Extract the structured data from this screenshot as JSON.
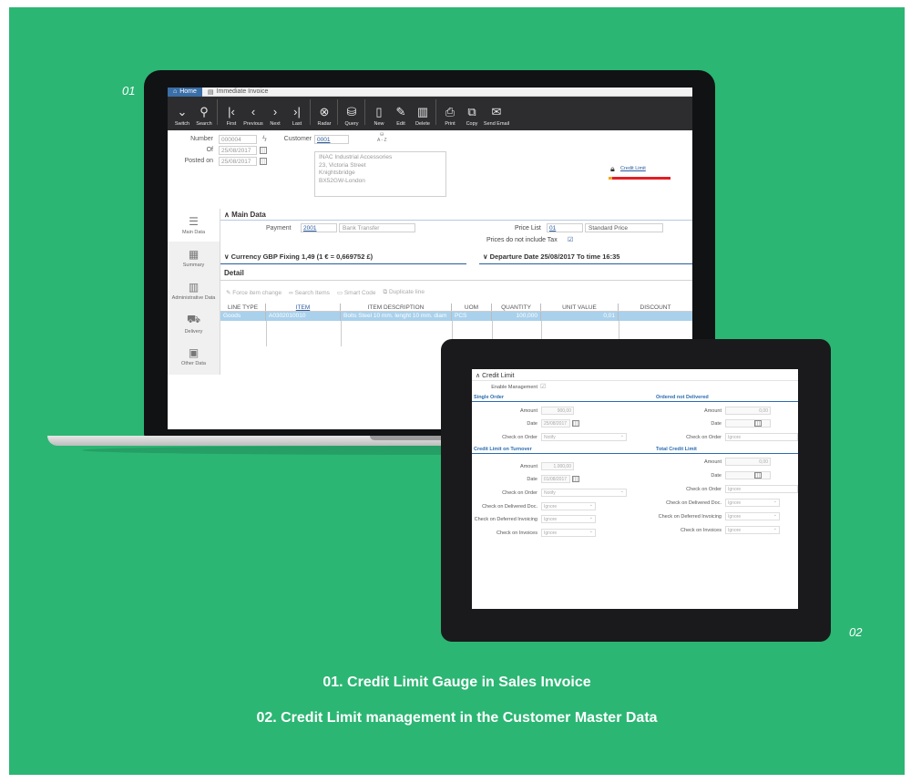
{
  "labels": {
    "one": "01",
    "two": "02"
  },
  "captions": {
    "first": "01. Credit Limit Gauge in Sales Invoice",
    "second": "02. Credit Limit management in the Customer Master Data"
  },
  "colors": {
    "background": "#2bb673",
    "gauge_red": "#e31e24",
    "gauge_orange": "#f5a623",
    "accent_blue": "#2b5c9f"
  },
  "app": {
    "tabs": {
      "home": "Home",
      "document": "Immediate Invoice"
    },
    "toolbar": [
      {
        "label": "Switch",
        "icon": "chevron-down-icon"
      },
      {
        "label": "Search",
        "icon": "search-icon"
      },
      {
        "label": "First",
        "icon": "first-icon"
      },
      {
        "label": "Previous",
        "icon": "previous-icon"
      },
      {
        "label": "Next",
        "icon": "next-icon"
      },
      {
        "label": "Last",
        "icon": "last-icon"
      },
      {
        "label": "Radar",
        "icon": "radar-icon"
      },
      {
        "label": "Query",
        "icon": "database-icon"
      },
      {
        "label": "New",
        "icon": "new-document-icon"
      },
      {
        "label": "Edit",
        "icon": "edit-icon"
      },
      {
        "label": "Delete",
        "icon": "delete-icon"
      },
      {
        "label": "Print",
        "icon": "print-icon"
      },
      {
        "label": "Copy",
        "icon": "copy-icon"
      },
      {
        "label": "Send Email",
        "icon": "email-icon"
      }
    ],
    "header": {
      "number_label": "Number",
      "number": "000004",
      "of_label": "Of",
      "of_date": "25/08/2017",
      "posted_label": "Posted on",
      "posted_date": "25/08/2017",
      "customer_label": "Customer",
      "customer_code": "0001",
      "sort_hint": "A - Z",
      "address": [
        "INAC Industrial Accessories",
        "23, Victoria Street",
        "Knightsbridge",
        "BX52GW-London"
      ],
      "credit_limit_link": "Credit Limit"
    },
    "sidenav": [
      "Main Data",
      "Summary",
      "Administrative Data",
      "Delivery",
      "Other Data"
    ],
    "main_data": {
      "title": "Main Data",
      "payment_label": "Payment",
      "payment_code": "2001",
      "payment_desc": "Bank Transfer",
      "price_list_label": "Price List",
      "price_list_code": "01",
      "price_list_desc": "Standard Price",
      "tax_label": "Prices do not include Tax",
      "currency_title": "Currency GBP Fixing 1,49 (1 € = 0,669752 £)",
      "departure_title": "Departure Date 25/08/2017 To time 16:35"
    },
    "detail": {
      "title": "Detail",
      "actions": [
        "Force item change",
        "Search Items",
        "Smart Code",
        "Duplicate line"
      ],
      "columns": [
        "LINE TYPE",
        "ITEM",
        "ITEM DESCRIPTION",
        "UOM",
        "QUANTITY",
        "UNIT VALUE",
        "DISCOUNT"
      ],
      "rows": [
        {
          "line_type": "Goods",
          "item": "A0302010010",
          "description": "Bolts Steel 10 mm. lenght 10 mm. diam",
          "uom": "PCS",
          "quantity": "100,000",
          "unit_value": "0,01",
          "discount": ""
        }
      ]
    }
  },
  "tablet": {
    "title": "Credit Limit",
    "enable_label": "Enable Management",
    "single_order": {
      "title": "Single Order",
      "amount_label": "Amount",
      "amount": "900,00",
      "date_label": "Date",
      "date": "25/08/2017",
      "check_label": "Check on Order",
      "check": "Notify"
    },
    "ordered_not_delivered": {
      "title": "Ordered not Delivered",
      "amount_label": "Amount",
      "amount": "0,00",
      "date_label": "Date",
      "check_label": "Check on Order",
      "check": "Ignore"
    },
    "turnover": {
      "title": "Credit Limit on Turnover",
      "amount_label": "Amount",
      "amount": "1.000,00",
      "date_label": "Date",
      "date": "01/08/2017",
      "check_order_label": "Check on Order",
      "check_order": "Notify",
      "check_delivered_label": "Check on Delivered Doc.",
      "check_delivered": "Ignore",
      "check_deferred_label": "Check on Deferred Invoicing",
      "check_deferred": "Ignore",
      "check_invoices_label": "Check on Invoices",
      "check_invoices": "Ignore"
    },
    "total": {
      "title": "Total Credit Limit",
      "amount_label": "Amount",
      "amount": "0,00",
      "date_label": "Date",
      "check_order_label": "Check on Order",
      "check_order": "Ignore",
      "check_delivered_label": "Check on Delivered Doc.",
      "check_delivered": "Ignore",
      "check_deferred_label": "Check on Deferred Invoicing",
      "check_deferred": "Ignore",
      "check_invoices_label": "Check on Invoices",
      "check_invoices": "Ignore"
    }
  }
}
